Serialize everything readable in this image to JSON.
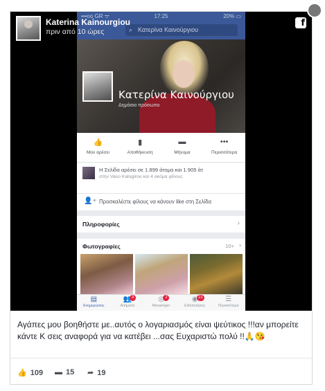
{
  "post": {
    "author": "Katerina Kainourgiou",
    "time": "πριν από 10 ώρες",
    "caption": "Αγάπες μου βοηθήστε με..αυτός ο λογαριασμός είναι ψεύτικος !!!αν μπορείτε κάντε Κ σεις αναφορά για να κατέβει ...σας Ευχαριστώ πολύ !!🙏😘",
    "stats": {
      "likes": "109",
      "comments": "15",
      "shares": "19"
    }
  },
  "screenshot": {
    "status_bar": {
      "carrier": "•••oo GR ᯤ",
      "time": "17:25",
      "battery": "20% ▭"
    },
    "search_placeholder": "Κατερίνα Καινούργιου",
    "page_name": "Κατερίνα Καινούργιου",
    "page_subtitle": "Δημόσιο πρόσωπο",
    "actions": [
      {
        "label": "Μου αρέσει",
        "icon": "thumbs-up-icon"
      },
      {
        "label": "Αποθήκευση",
        "icon": "bookmark-icon"
      },
      {
        "label": "Μήνυμα",
        "icon": "message-icon"
      },
      {
        "label": "Περισσότερα",
        "icon": "more-icon"
      }
    ],
    "likes_text": "Η Σελίδα αρέσει σε 1.899 άτομα και 1.905 άτ",
    "likes_subtext": "στην Vaso Kalogirou και 4 ακόμα φίλους",
    "invite_text": "Προσκαλέστε φίλους να κάνουν like στη Σελίδα",
    "info_label": "Πληροφορίες",
    "photos_label": "Φωτογραφίες",
    "photos_count": "10+",
    "tabs": [
      {
        "label": "Ενημερώσεις",
        "badge": ""
      },
      {
        "label": "Αιτήματα",
        "badge": "3"
      },
      {
        "label": "Messenger",
        "badge": "2"
      },
      {
        "label": "Ειδοποιήσεις",
        "badge": "21"
      },
      {
        "label": "Περισσότερα",
        "badge": ""
      }
    ]
  },
  "colors": {
    "facebook_blue": "#3b5998",
    "badge_red": "#e41e3f",
    "media_bg": "#000000"
  }
}
